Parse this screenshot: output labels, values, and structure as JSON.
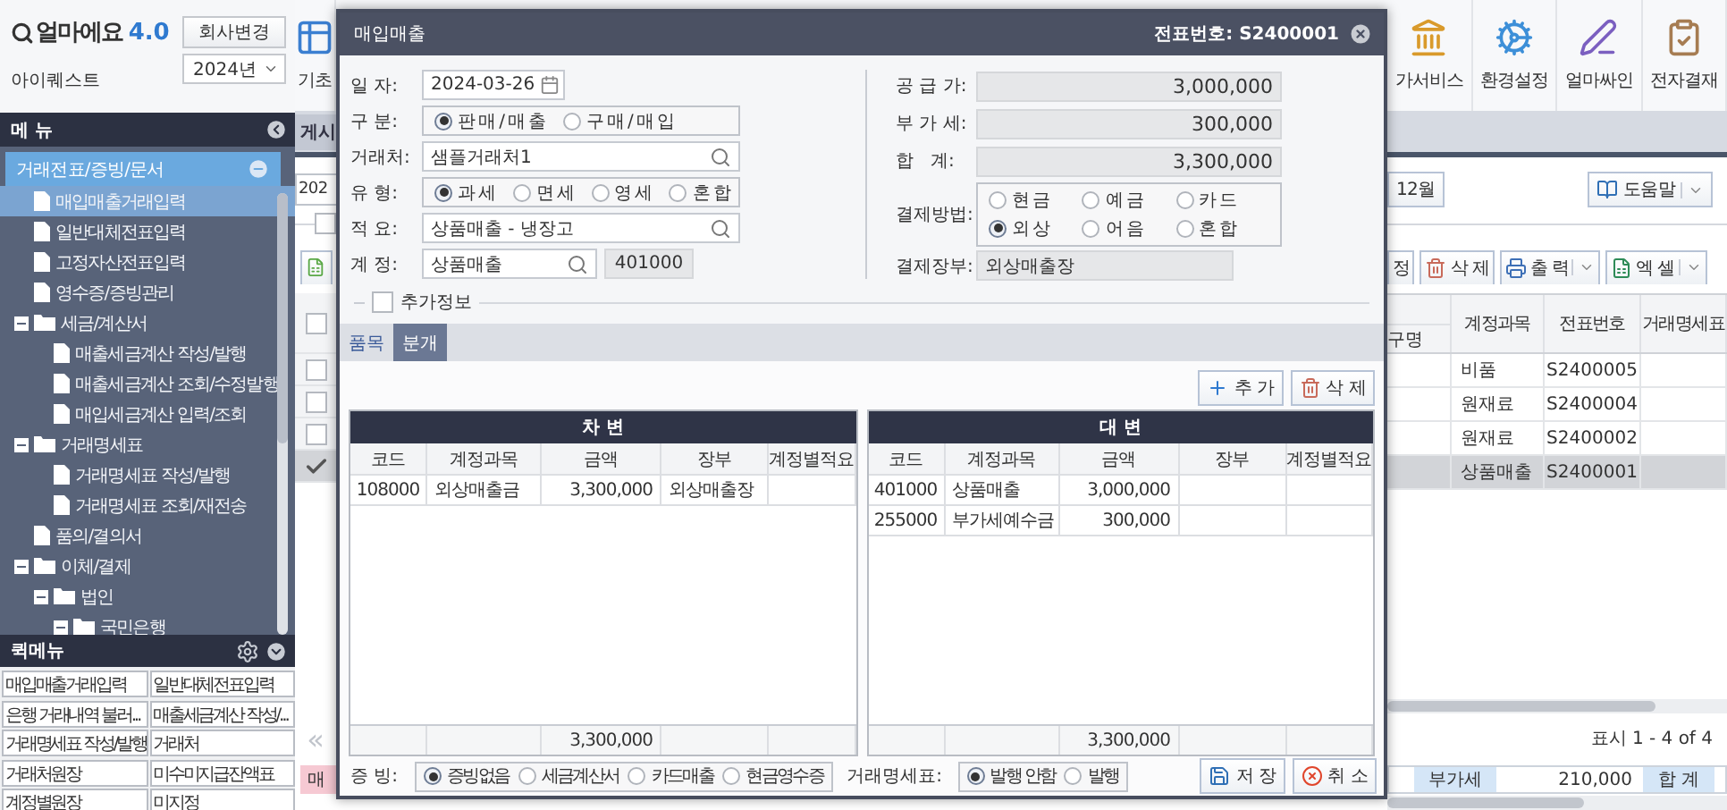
{
  "app": {
    "logo": "얼마에요",
    "version": "4.0",
    "company": "아이퀘스트",
    "change_company": "회사변경",
    "year": "2024년"
  },
  "menu": {
    "title": "메 뉴",
    "tree": [
      {
        "label": "거래전표/증빙/문서",
        "kind": "section",
        "expanded": true,
        "selected": false,
        "children": [
          {
            "label": "매입매출거래입력",
            "kind": "doc",
            "selected": true
          },
          {
            "label": "일반대체전표입력",
            "kind": "doc",
            "selected": false
          },
          {
            "label": "고정자산전표입력",
            "kind": "doc",
            "selected": false
          },
          {
            "label": "영수증/증빙관리",
            "kind": "doc",
            "selected": false
          },
          {
            "label": "세금/계산서",
            "kind": "folder",
            "expanded": true,
            "selected": false,
            "children": [
              {
                "label": "매출세금계산 작성/발행",
                "kind": "doc",
                "selected": false
              },
              {
                "label": "매출세금계산 조회/수정발행",
                "kind": "doc",
                "selected": false
              },
              {
                "label": "매입세금계산 입력/조회",
                "kind": "doc",
                "selected": false
              }
            ]
          },
          {
            "label": "거래명세표",
            "kind": "folder",
            "expanded": true,
            "selected": false,
            "children": [
              {
                "label": "거래명세표 작성/발행",
                "kind": "doc",
                "selected": false
              },
              {
                "label": "거래명세표 조회/재전송",
                "kind": "doc",
                "selected": false
              }
            ]
          },
          {
            "label": "품의/결의서",
            "kind": "doc",
            "selected": false
          },
          {
            "label": "이체/결제",
            "kind": "folder",
            "expanded": true,
            "selected": false,
            "children": [
              {
                "label": "법인",
                "kind": "folder",
                "expanded": true,
                "selected": false,
                "children": [
                  {
                    "label": "국민은행",
                    "kind": "folder",
                    "expanded": true,
                    "selected": false
                  }
                ]
              }
            ]
          }
        ]
      }
    ]
  },
  "quick_menu": {
    "title": "퀵메뉴",
    "items": [
      "매입매출거래입력",
      "일반대체전표입력",
      "은행 거래내역 불러...",
      "매출세금계산 작성/...",
      "거래명세표 작성/발행",
      "거래처",
      "거래처원장",
      "미수미지급잔액표",
      "계정별원장",
      "미지정"
    ]
  },
  "toolbar": [
    {
      "label": "기초",
      "kind": "basic"
    },
    {
      "label": "가서비스",
      "kind": "bank"
    },
    {
      "label": "환경설정",
      "kind": "gear"
    },
    {
      "label": "얼마싸인",
      "kind": "sign"
    },
    {
      "label": "전자결재",
      "kind": "approval"
    }
  ],
  "tab": "게시",
  "filters": {
    "year": "202",
    "month": "12월",
    "help": "도움말",
    "options_checked": false
  },
  "actions": [
    {
      "label": "정",
      "kind": "edit"
    },
    {
      "label": "삭 제",
      "kind": "delete"
    },
    {
      "label": "출 력",
      "kind": "print"
    },
    {
      "label": "엑 셀",
      "kind": "excel"
    }
  ],
  "grid": {
    "columns": [
      "구명",
      "계정과목",
      "전표번호",
      "거래명세표"
    ],
    "all_checked": false,
    "rows": [
      {
        "account": "비품",
        "voucher": "S2400005",
        "checked": false,
        "selected": false
      },
      {
        "account": "원재료",
        "voucher": "S2400004",
        "checked": false,
        "selected": false
      },
      {
        "account": "원재료",
        "voucher": "S2400002",
        "checked": false,
        "selected": false
      },
      {
        "account": "상품매출",
        "voucher": "S2400001",
        "checked": true,
        "selected": true
      }
    ]
  },
  "pager": {
    "prev": "«",
    "info": "표시 1 - 4 of 4"
  },
  "summary": {
    "tab": "매",
    "vat_label": "부가세",
    "vat": "210,000",
    "total_label": "합 계"
  },
  "dialog": {
    "title": "매입매출",
    "voucher": "전표번호: S2400001",
    "left_fields": [
      {
        "label": "일 자:",
        "kind": "date",
        "value": "2024-03-26"
      },
      {
        "label": "구 분:",
        "kind": "radio",
        "options": [
          {
            "label": "판 매 / 매 출",
            "selected": true
          },
          {
            "label": "구 매 / 매 입",
            "selected": false
          }
        ]
      },
      {
        "label": "거래처:",
        "kind": "search",
        "value": "샘플거래처1"
      },
      {
        "label": "유 형:",
        "kind": "radio",
        "options": [
          {
            "label": "과 세",
            "selected": true
          },
          {
            "label": "면 세",
            "selected": false
          },
          {
            "label": "영 세",
            "selected": false
          },
          {
            "label": "혼 합",
            "selected": false
          }
        ]
      },
      {
        "label": "적 요:",
        "kind": "search",
        "value": "상품매출 - 냉장고"
      },
      {
        "label": "계 정:",
        "kind": "account",
        "value": "상품매출",
        "code": "401000"
      }
    ],
    "right_fields": [
      {
        "label": "공 급 가:",
        "kind": "amount",
        "value": "3,000,000"
      },
      {
        "label": "부 가 세:",
        "kind": "amount",
        "value": "300,000"
      },
      {
        "label": "합   계:",
        "kind": "amount",
        "value": "3,300,000"
      },
      {
        "label": "결제방법:",
        "kind": "radio_grid",
        "options": [
          {
            "label": "현 금",
            "selected": false
          },
          {
            "label": "예 금",
            "selected": false
          },
          {
            "label": "카 드",
            "selected": false
          },
          {
            "label": "외 상",
            "selected": true
          },
          {
            "label": "어 음",
            "selected": false
          },
          {
            "label": "혼 합",
            "selected": false
          }
        ]
      },
      {
        "label": "결제장부:",
        "kind": "readonly",
        "value": "외상매출장"
      }
    ],
    "extra_info": {
      "label": "추가정보",
      "checked": false
    },
    "tabs": [
      {
        "label": "품목",
        "selected": false
      },
      {
        "label": "분개",
        "selected": true
      }
    ],
    "buttons": [
      {
        "label": "추 가",
        "kind": "add"
      },
      {
        "label": "삭 제",
        "kind": "delete"
      }
    ],
    "debit": {
      "title": "차 변",
      "columns": [
        "코드",
        "계정과목",
        "금액",
        "장부",
        "계정별적요"
      ],
      "rows": [
        {
          "code": "108000",
          "account": "외상매출금",
          "amount": "3,300,000",
          "ledger": "외상매출장"
        }
      ],
      "total": "3,300,000"
    },
    "credit": {
      "title": "대 변",
      "columns": [
        "코드",
        "계정과목",
        "금액",
        "장부",
        "계정별적요"
      ],
      "rows": [
        {
          "code": "401000",
          "account": "상품매출",
          "amount": "3,000,000"
        },
        {
          "code": "255000",
          "account": "부가세예수금",
          "amount": "300,000"
        }
      ],
      "total": "3,300,000"
    },
    "evidence": {
      "label": "증 빙:",
      "options": [
        {
          "label": "증빙없음",
          "selected": true
        },
        {
          "label": "세금계산서",
          "selected": false
        },
        {
          "label": "카드매출",
          "selected": false
        },
        {
          "label": "현금영수증",
          "selected": false
        }
      ]
    },
    "statement": {
      "label": "거래명세표:",
      "options": [
        {
          "label": "발행 안함",
          "selected": true
        },
        {
          "label": "발행",
          "selected": false
        }
      ]
    },
    "actions": [
      {
        "label": "저 장",
        "kind": "save"
      },
      {
        "label": "취 소",
        "kind": "cancel"
      }
    ]
  }
}
